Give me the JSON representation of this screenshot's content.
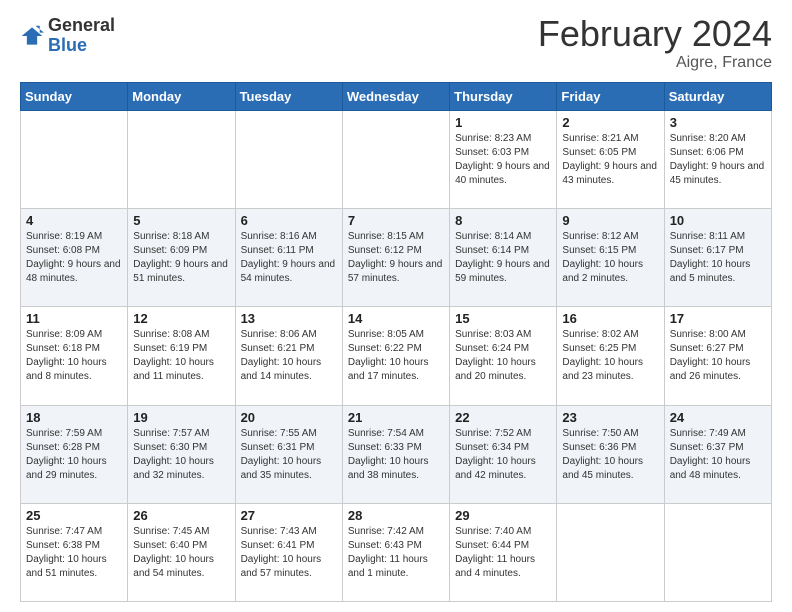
{
  "logo": {
    "general": "General",
    "blue": "Blue"
  },
  "header": {
    "title": "February 2024",
    "subtitle": "Aigre, France"
  },
  "weekdays": [
    "Sunday",
    "Monday",
    "Tuesday",
    "Wednesday",
    "Thursday",
    "Friday",
    "Saturday"
  ],
  "weeks": [
    [
      {
        "day": "",
        "info": ""
      },
      {
        "day": "",
        "info": ""
      },
      {
        "day": "",
        "info": ""
      },
      {
        "day": "",
        "info": ""
      },
      {
        "day": "1",
        "info": "Sunrise: 8:23 AM\nSunset: 6:03 PM\nDaylight: 9 hours and 40 minutes."
      },
      {
        "day": "2",
        "info": "Sunrise: 8:21 AM\nSunset: 6:05 PM\nDaylight: 9 hours and 43 minutes."
      },
      {
        "day": "3",
        "info": "Sunrise: 8:20 AM\nSunset: 6:06 PM\nDaylight: 9 hours and 45 minutes."
      }
    ],
    [
      {
        "day": "4",
        "info": "Sunrise: 8:19 AM\nSunset: 6:08 PM\nDaylight: 9 hours and 48 minutes."
      },
      {
        "day": "5",
        "info": "Sunrise: 8:18 AM\nSunset: 6:09 PM\nDaylight: 9 hours and 51 minutes."
      },
      {
        "day": "6",
        "info": "Sunrise: 8:16 AM\nSunset: 6:11 PM\nDaylight: 9 hours and 54 minutes."
      },
      {
        "day": "7",
        "info": "Sunrise: 8:15 AM\nSunset: 6:12 PM\nDaylight: 9 hours and 57 minutes."
      },
      {
        "day": "8",
        "info": "Sunrise: 8:14 AM\nSunset: 6:14 PM\nDaylight: 9 hours and 59 minutes."
      },
      {
        "day": "9",
        "info": "Sunrise: 8:12 AM\nSunset: 6:15 PM\nDaylight: 10 hours and 2 minutes."
      },
      {
        "day": "10",
        "info": "Sunrise: 8:11 AM\nSunset: 6:17 PM\nDaylight: 10 hours and 5 minutes."
      }
    ],
    [
      {
        "day": "11",
        "info": "Sunrise: 8:09 AM\nSunset: 6:18 PM\nDaylight: 10 hours and 8 minutes."
      },
      {
        "day": "12",
        "info": "Sunrise: 8:08 AM\nSunset: 6:19 PM\nDaylight: 10 hours and 11 minutes."
      },
      {
        "day": "13",
        "info": "Sunrise: 8:06 AM\nSunset: 6:21 PM\nDaylight: 10 hours and 14 minutes."
      },
      {
        "day": "14",
        "info": "Sunrise: 8:05 AM\nSunset: 6:22 PM\nDaylight: 10 hours and 17 minutes."
      },
      {
        "day": "15",
        "info": "Sunrise: 8:03 AM\nSunset: 6:24 PM\nDaylight: 10 hours and 20 minutes."
      },
      {
        "day": "16",
        "info": "Sunrise: 8:02 AM\nSunset: 6:25 PM\nDaylight: 10 hours and 23 minutes."
      },
      {
        "day": "17",
        "info": "Sunrise: 8:00 AM\nSunset: 6:27 PM\nDaylight: 10 hours and 26 minutes."
      }
    ],
    [
      {
        "day": "18",
        "info": "Sunrise: 7:59 AM\nSunset: 6:28 PM\nDaylight: 10 hours and 29 minutes."
      },
      {
        "day": "19",
        "info": "Sunrise: 7:57 AM\nSunset: 6:30 PM\nDaylight: 10 hours and 32 minutes."
      },
      {
        "day": "20",
        "info": "Sunrise: 7:55 AM\nSunset: 6:31 PM\nDaylight: 10 hours and 35 minutes."
      },
      {
        "day": "21",
        "info": "Sunrise: 7:54 AM\nSunset: 6:33 PM\nDaylight: 10 hours and 38 minutes."
      },
      {
        "day": "22",
        "info": "Sunrise: 7:52 AM\nSunset: 6:34 PM\nDaylight: 10 hours and 42 minutes."
      },
      {
        "day": "23",
        "info": "Sunrise: 7:50 AM\nSunset: 6:36 PM\nDaylight: 10 hours and 45 minutes."
      },
      {
        "day": "24",
        "info": "Sunrise: 7:49 AM\nSunset: 6:37 PM\nDaylight: 10 hours and 48 minutes."
      }
    ],
    [
      {
        "day": "25",
        "info": "Sunrise: 7:47 AM\nSunset: 6:38 PM\nDaylight: 10 hours and 51 minutes."
      },
      {
        "day": "26",
        "info": "Sunrise: 7:45 AM\nSunset: 6:40 PM\nDaylight: 10 hours and 54 minutes."
      },
      {
        "day": "27",
        "info": "Sunrise: 7:43 AM\nSunset: 6:41 PM\nDaylight: 10 hours and 57 minutes."
      },
      {
        "day": "28",
        "info": "Sunrise: 7:42 AM\nSunset: 6:43 PM\nDaylight: 11 hours and 1 minute."
      },
      {
        "day": "29",
        "info": "Sunrise: 7:40 AM\nSunset: 6:44 PM\nDaylight: 11 hours and 4 minutes."
      },
      {
        "day": "",
        "info": ""
      },
      {
        "day": "",
        "info": ""
      }
    ]
  ]
}
